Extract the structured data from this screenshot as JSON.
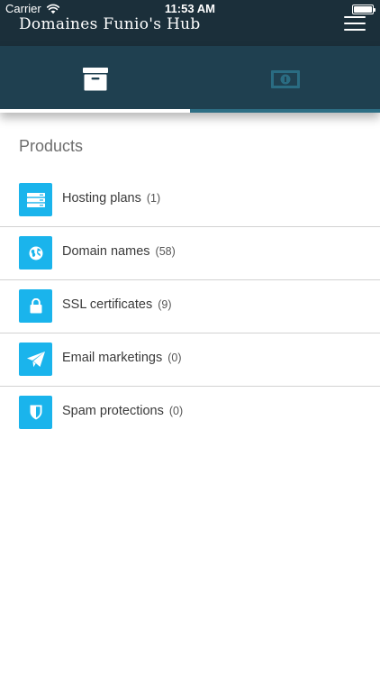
{
  "status_bar": {
    "carrier": "Carrier",
    "time": "11:53 AM"
  },
  "header": {
    "title": "Domaines Funio's Hub"
  },
  "tabs": [
    {
      "icon": "archive-box-icon",
      "active": true
    },
    {
      "icon": "money-bill-icon",
      "active": false
    }
  ],
  "products": {
    "title": "Products",
    "items": [
      {
        "label": "Hosting plans",
        "count": "(1)",
        "icon": "server-icon"
      },
      {
        "label": "Domain names",
        "count": "(58)",
        "icon": "globe-icon"
      },
      {
        "label": "SSL certificates",
        "count": "(9)",
        "icon": "lock-icon"
      },
      {
        "label": "Email marketings",
        "count": "(0)",
        "icon": "paper-plane-icon"
      },
      {
        "label": "Spam protections",
        "count": "(0)",
        "icon": "shield-icon"
      }
    ]
  },
  "colors": {
    "header_bg": "#1b2f3a",
    "tab_bar_bg": "#1f4050",
    "tab_inactive_indicator": "#2d6e84",
    "icon_tile": "#1ab4ec",
    "inactive_tab_icon": "#2a6c82"
  }
}
